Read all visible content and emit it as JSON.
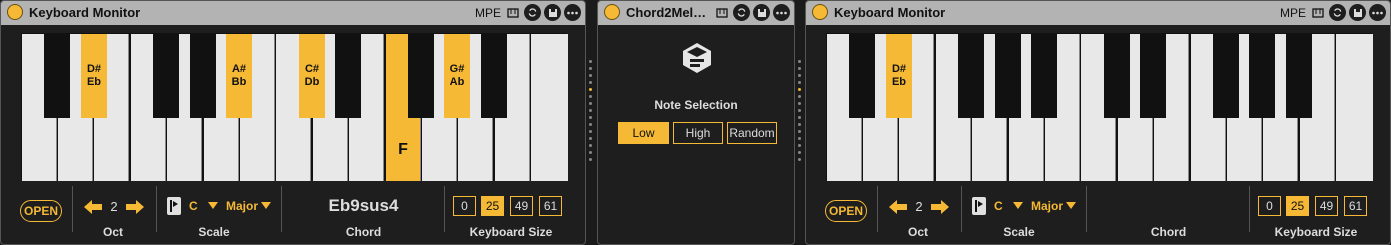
{
  "colors": {
    "accent": "#f5b935",
    "panel": "#1e1e1e",
    "titlebar": "#b3b3b3"
  },
  "left_device": {
    "title": "Keyboard Monitor",
    "mpe": "MPE",
    "icons": [
      "keyboard-icon",
      "hotswap-icon",
      "save-icon",
      "more-icon"
    ],
    "highlighted_keys": [
      {
        "sharp": "D#",
        "flat": "Eb"
      },
      {
        "sharp": "A#",
        "flat": "Bb"
      },
      {
        "sharp": "C#",
        "flat": "Db"
      },
      {
        "natural": "F"
      },
      {
        "sharp": "G#",
        "flat": "Ab"
      }
    ],
    "open_label": "OPEN",
    "octave_value": "2",
    "octave_label": "Oct",
    "scale_root": "C",
    "scale_mode": "Major",
    "scale_label": "Scale",
    "chord_value": "Eb9sus4",
    "chord_label": "Chord",
    "keyboard_sizes": [
      "0",
      "25",
      "49",
      "61"
    ],
    "keyboard_size_selected": "25",
    "keyboard_size_label": "Keyboard Size"
  },
  "middle_device": {
    "title": "Chord2Mel…",
    "icons": [
      "keyboard-icon",
      "hotswap-icon",
      "save-icon",
      "more-icon"
    ],
    "note_selection_label": "Note Selection",
    "options": [
      "Low",
      "High",
      "Random"
    ],
    "selected_option": "Low"
  },
  "right_device": {
    "title": "Keyboard Monitor",
    "mpe": "MPE",
    "icons": [
      "keyboard-icon",
      "hotswap-icon",
      "save-icon",
      "more-icon"
    ],
    "highlighted_keys": [
      {
        "sharp": "D#",
        "flat": "Eb"
      }
    ],
    "open_label": "OPEN",
    "octave_value": "2",
    "octave_label": "Oct",
    "scale_root": "C",
    "scale_mode": "Major",
    "scale_label": "Scale",
    "chord_value": "",
    "chord_label": "Chord",
    "keyboard_sizes": [
      "0",
      "25",
      "49",
      "61"
    ],
    "keyboard_size_selected": "25",
    "keyboard_size_label": "Keyboard Size"
  }
}
